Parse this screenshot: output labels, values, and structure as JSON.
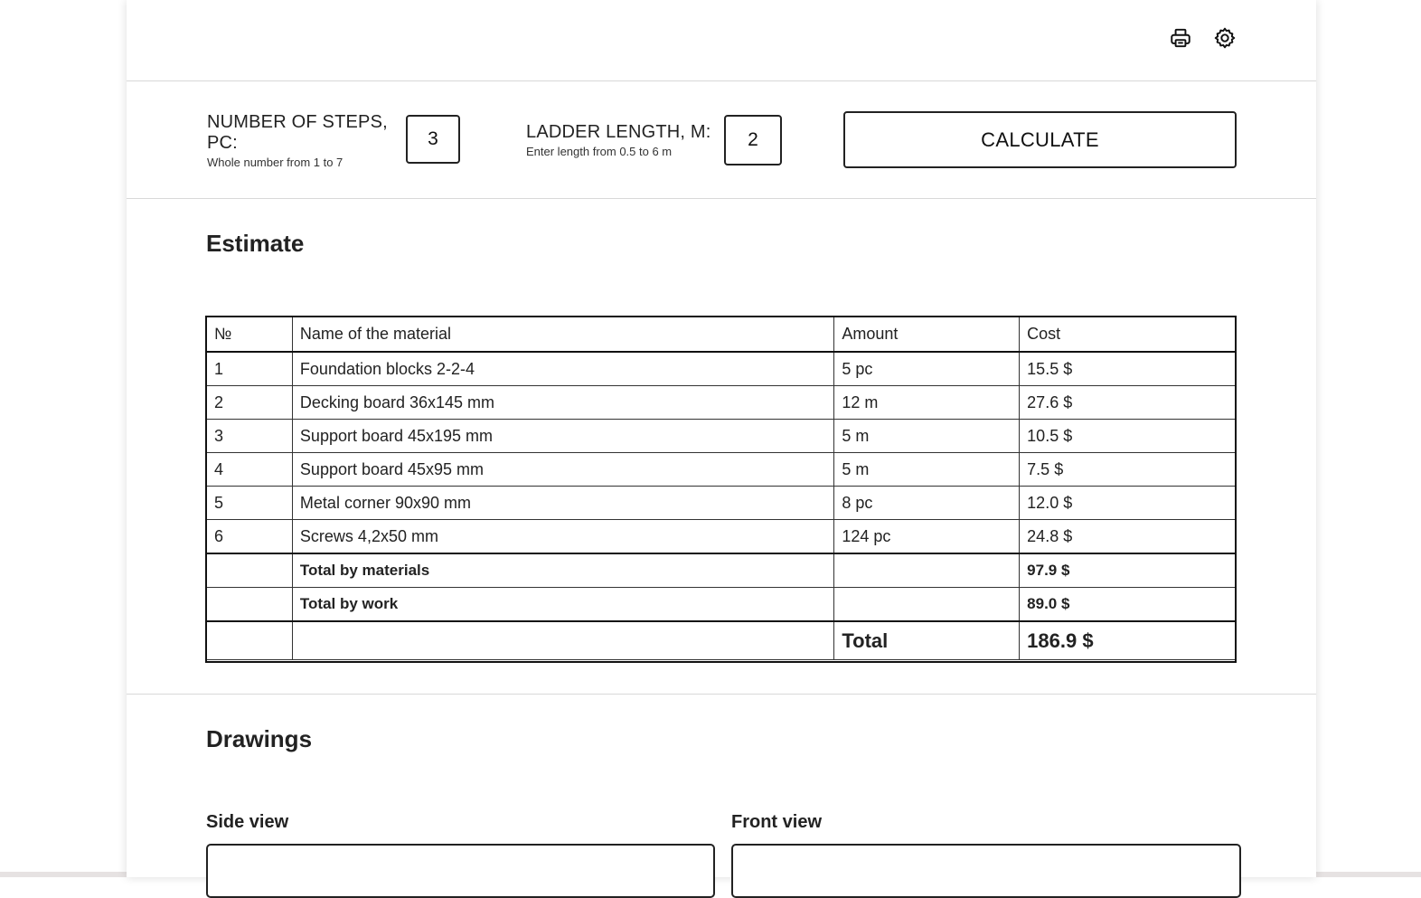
{
  "toolbar": {
    "print_icon": "printer-icon",
    "settings_icon": "gear-icon"
  },
  "form": {
    "steps_label": "NUMBER OF STEPS, PC:",
    "steps_hint": "Whole number from 1 to 7",
    "steps_value": "3",
    "length_label": "LADDER LENGTH, M:",
    "length_hint": "Enter length from 0.5 to 6 m",
    "length_value": "2",
    "calculate_label": "CALCULATE"
  },
  "estimate": {
    "title": "Estimate",
    "headers": [
      "№",
      "Name of the material",
      "Amount",
      "Cost"
    ],
    "rows": [
      {
        "no": "1",
        "name": "Foundation blocks 2-2-4",
        "amount": "5 pc",
        "cost": "15.5 $"
      },
      {
        "no": "2",
        "name": "Decking board 36x145 mm",
        "amount": "12 m",
        "cost": "27.6 $"
      },
      {
        "no": "3",
        "name": "Support board 45x195 mm",
        "amount": "5 m",
        "cost": "10.5 $"
      },
      {
        "no": "4",
        "name": "Support board 45x95 mm",
        "amount": "5 m",
        "cost": "7.5 $"
      },
      {
        "no": "5",
        "name": "Metal corner 90x90 mm",
        "amount": "8 pc",
        "cost": "12.0 $"
      },
      {
        "no": "6",
        "name": "Screws 4,2x50 mm",
        "amount": "124 pc",
        "cost": "24.8 $"
      }
    ],
    "total_materials_label": "Total by materials",
    "total_materials_value": "97.9 $",
    "total_work_label": "Total by work",
    "total_work_value": "89.0 $",
    "total_label": "Total",
    "total_value": "186.9 $"
  },
  "drawings": {
    "title": "Drawings",
    "side_view_label": "Side view",
    "front_view_label": "Front view"
  }
}
